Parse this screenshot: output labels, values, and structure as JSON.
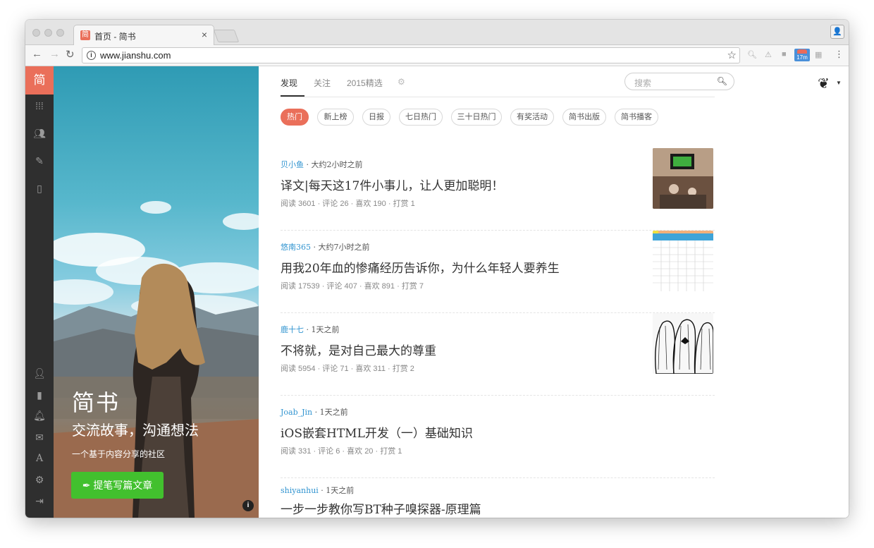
{
  "browser": {
    "tab_title": "首页 - 简书",
    "tab_favicon": "简",
    "tab_close": "×",
    "url": "www.jianshu.com",
    "ext_badge": "17m"
  },
  "sidebar": {
    "logo": "简",
    "icons": [
      "grid-icon",
      "users-icon",
      "pencil-icon",
      "mobile-icon",
      "user-icon",
      "bookmark-icon",
      "bell-icon",
      "mail-icon",
      "font-icon",
      "gears-icon",
      "signout-icon"
    ]
  },
  "hero": {
    "title": "简书",
    "subtitle": "交流故事，沟通想法",
    "description": "一个基于内容分享的社区",
    "button": "提笔写篇文章"
  },
  "nav": {
    "tabs": [
      "发现",
      "关注",
      "2015精选"
    ],
    "search_placeholder": "搜索"
  },
  "pills": [
    "热门",
    "新上榜",
    "日报",
    "七日热门",
    "三十日热门",
    "有奖活动",
    "简书出版",
    "简书播客"
  ],
  "articles": [
    {
      "author": "贝小鱼",
      "time": " · 大约2小时之前",
      "title": "译文|每天这17件小事儿，让人更加聪明！",
      "stats": "阅读 3601 · 评论 26 · 喜欢 190 · 打赏 1"
    },
    {
      "author": "悠南365",
      "time": " · 大约7小时之前",
      "title": "用我20年血的惨痛经历告诉你，为什么年轻人要养生",
      "stats": "阅读 17539 · 评论 407 · 喜欢 891 · 打赏 7"
    },
    {
      "author": "鹿十七",
      "time": " · 1天之前",
      "title": "不将就，是对自己最大的尊重",
      "stats": "阅读 5954 · 评论 71 · 喜欢 311 · 打赏 2"
    },
    {
      "author": "Joab_Jin",
      "time": " · 1天之前",
      "title": "iOS嵌套HTML开发（一）基础知识",
      "stats": "阅读 331 · 评论 6 · 喜欢 20 · 打赏 1"
    },
    {
      "author": "shiyanhui",
      "time": " · 1天之前",
      "title": "一步一步教你写BT种子嗅探器-原理篇",
      "stats": ""
    }
  ],
  "colors": {
    "brand": "#ea6f5a",
    "green": "#42c02e",
    "link": "#3194d0"
  }
}
